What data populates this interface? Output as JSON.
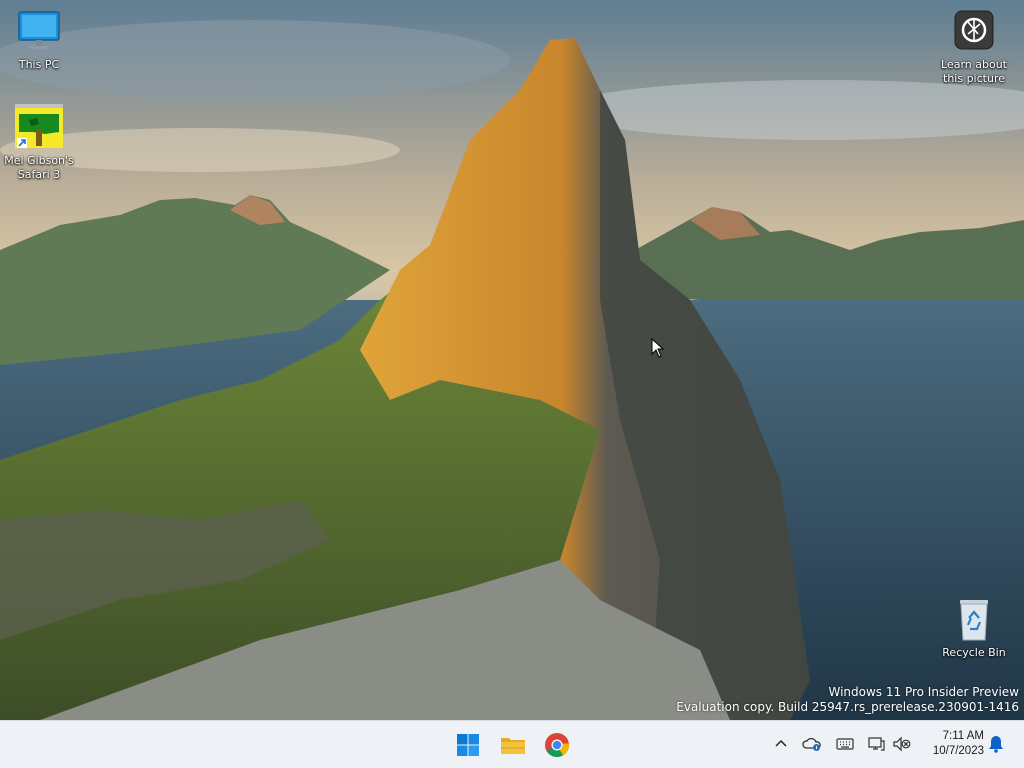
{
  "desktop": {
    "icons": {
      "this_pc": "This PC",
      "safari": "Mel Gibson's Safari 3",
      "recycle_bin": "Recycle Bin",
      "learn": "Learn about this picture"
    },
    "watermark": {
      "line1": "Windows 11 Pro Insider Preview",
      "line2": "Evaluation copy. Build 25947.rs_prerelease.230901-1416"
    }
  },
  "taskbar": {
    "apps": [
      {
        "name": "Start",
        "icon": "windows-logo-icon"
      },
      {
        "name": "File Explorer",
        "icon": "folder-icon"
      },
      {
        "name": "Google Chrome",
        "icon": "chrome-icon"
      }
    ],
    "tray": {
      "icons": [
        "chevron-up-icon",
        "onedrive-icon",
        "keyboard-icon",
        "network-icon",
        "volume-muted-icon",
        "notification-bell-icon"
      ],
      "time": "7:11 AM",
      "date": "10/7/2023"
    }
  },
  "colors": {
    "taskbar_bg": "#eef1f5",
    "start_blue": "#0a78d4",
    "folder_yellow": "#f4c33d",
    "notify_blue": "#0b63c8"
  }
}
